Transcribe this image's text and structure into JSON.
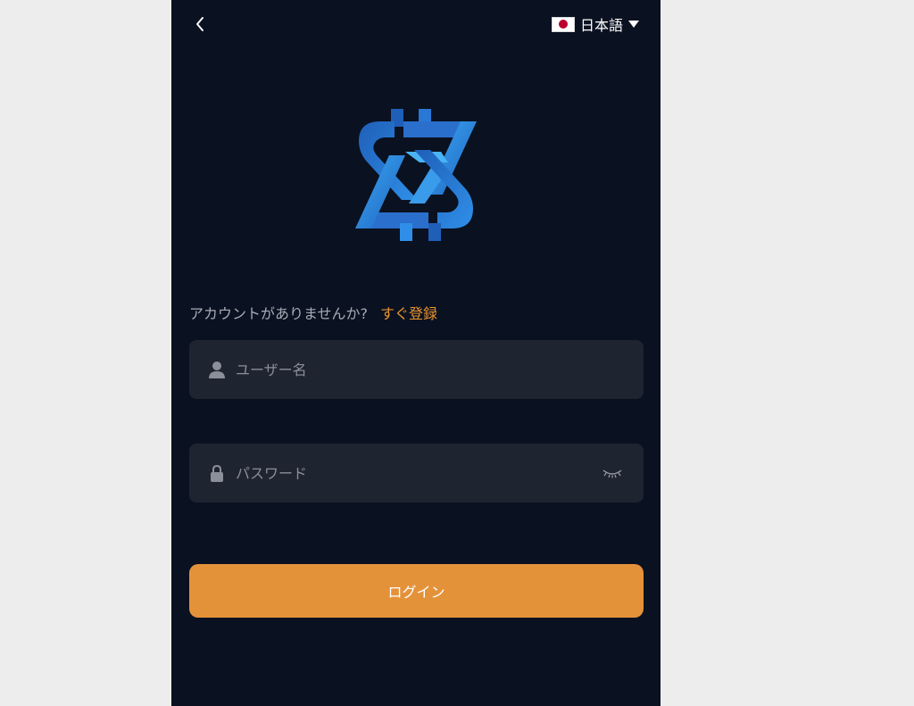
{
  "header": {
    "back_icon": "chevron-left-icon",
    "language": {
      "flag_icon": "japan-flag-icon",
      "label": "日本語",
      "caret_icon": "caret-down-icon"
    }
  },
  "logo": {
    "icon": "app-logo",
    "colors": [
      "#1f5fb8",
      "#2a8ae6",
      "#49b3f5"
    ]
  },
  "signup": {
    "prompt": "アカウントがありませんか?",
    "link_label": "すぐ登録"
  },
  "form": {
    "username": {
      "icon": "user-icon",
      "placeholder": "ユーザー名",
      "value": ""
    },
    "password": {
      "icon": "lock-icon",
      "placeholder": "パスワード",
      "value": "",
      "visibility_icon": "eye-closed-icon"
    },
    "submit_label": "ログイン"
  },
  "colors": {
    "background": "#0a1120",
    "field_bg": "#1e2430",
    "accent": "#e4923a",
    "link": "#e8932f",
    "muted_text": "#a7abb5"
  }
}
